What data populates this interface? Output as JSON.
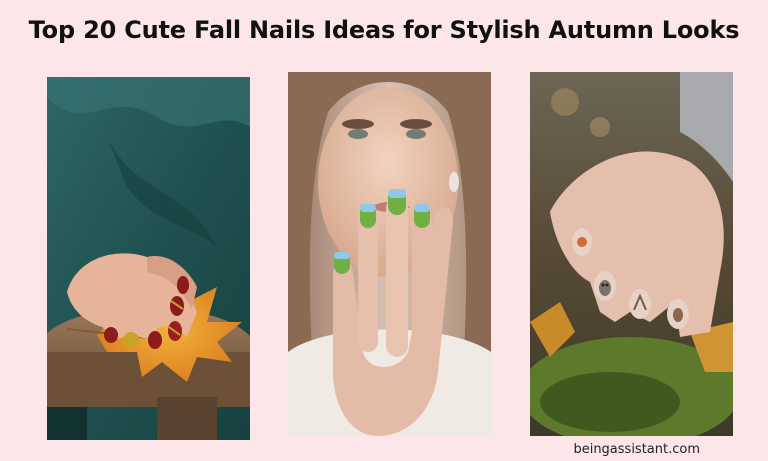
{
  "header": {
    "title": "Top 20 Cute Fall Nails Ideas for Stylish Autumn Looks"
  },
  "footer": {
    "site": "beingassistant.com"
  },
  "colors": {
    "page_bg": "#fce6ea",
    "title_text": "#111111",
    "nail_red": "#8c1b1b",
    "nail_gold": "#c9a227",
    "nail_green": "#6fb043",
    "nail_nude": "#d9c2b6"
  },
  "photos": [
    {
      "id": "photo-1",
      "subject": "hand-with-red-gold-nails-and-maple-leaf"
    },
    {
      "id": "photo-2",
      "subject": "woman-showing-green-landscape-nails"
    },
    {
      "id": "photo-3",
      "subject": "hand-with-woodland-animal-nail-art"
    }
  ]
}
